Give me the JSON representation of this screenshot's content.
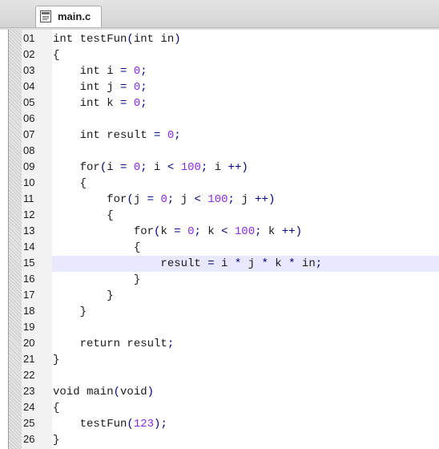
{
  "tab": {
    "filename": "main.c",
    "icon": "c-file-icon"
  },
  "editor": {
    "highlighted_line": "15",
    "lines": [
      {
        "num": "01",
        "text": "int testFun(int in)"
      },
      {
        "num": "02",
        "text": "{"
      },
      {
        "num": "03",
        "text": "    int i = 0;"
      },
      {
        "num": "04",
        "text": "    int j = 0;"
      },
      {
        "num": "05",
        "text": "    int k = 0;"
      },
      {
        "num": "06",
        "text": ""
      },
      {
        "num": "07",
        "text": "    int result = 0;"
      },
      {
        "num": "08",
        "text": ""
      },
      {
        "num": "09",
        "text": "    for(i = 0; i < 100; i ++)"
      },
      {
        "num": "10",
        "text": "    {"
      },
      {
        "num": "11",
        "text": "        for(j = 0; j < 100; j ++)"
      },
      {
        "num": "12",
        "text": "        {"
      },
      {
        "num": "13",
        "text": "            for(k = 0; k < 100; k ++)"
      },
      {
        "num": "14",
        "text": "            {"
      },
      {
        "num": "15",
        "text": "                result = i * j * k * in;"
      },
      {
        "num": "16",
        "text": "            }"
      },
      {
        "num": "17",
        "text": "        }"
      },
      {
        "num": "18",
        "text": "    }"
      },
      {
        "num": "19",
        "text": ""
      },
      {
        "num": "20",
        "text": "    return result;"
      },
      {
        "num": "21",
        "text": "}"
      },
      {
        "num": "22",
        "text": ""
      },
      {
        "num": "23",
        "text": "void main(void)"
      },
      {
        "num": "24",
        "text": "{"
      },
      {
        "num": "25",
        "text": "    testFun(123);"
      },
      {
        "num": "26",
        "text": "}"
      }
    ]
  },
  "colors": {
    "highlight": "#e8e8ff",
    "number": "#8a2be2",
    "operator": "#000080"
  }
}
